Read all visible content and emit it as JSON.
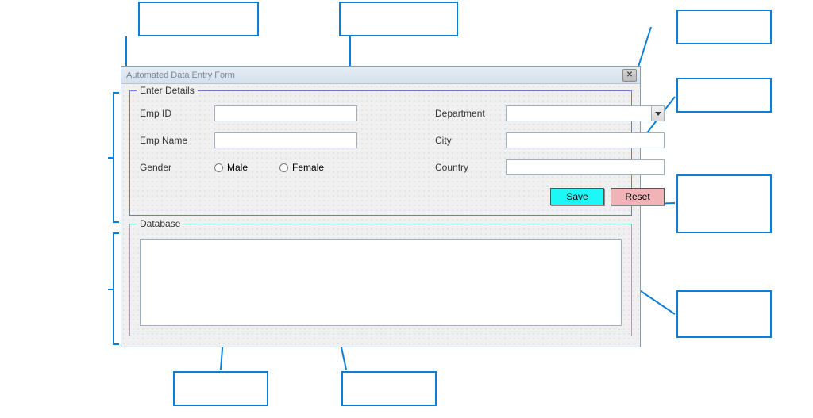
{
  "window": {
    "title": "Automated Data Entry Form"
  },
  "enterDetails": {
    "legend": "Enter Details",
    "labels": {
      "empId": "Emp ID",
      "empName": "Emp Name",
      "gender": "Gender",
      "department": "Department",
      "city": "City",
      "country": "Country"
    },
    "values": {
      "empId": "",
      "empName": "",
      "department": "",
      "city": "",
      "country": ""
    },
    "gender": {
      "maleLabel": "Male",
      "femaleLabel": "Female"
    },
    "buttons": {
      "save": "Save",
      "reset": "Reset"
    }
  },
  "database": {
    "legend": "Database"
  }
}
